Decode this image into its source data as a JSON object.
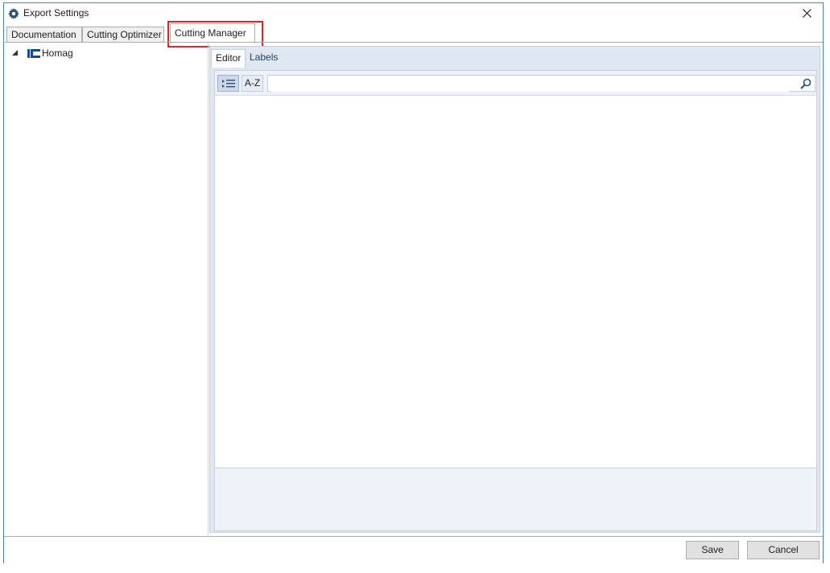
{
  "window": {
    "title": "Export Settings",
    "icon": "gear-icon"
  },
  "top_tabs": [
    {
      "label": "Documentation",
      "active": false
    },
    {
      "label": "Cutting Optimizer",
      "active": false
    },
    {
      "label": "Cutting Manager",
      "active": true
    }
  ],
  "tree": {
    "items": [
      {
        "label": "Homag",
        "expanded": true,
        "icon": "homag-logo-icon"
      }
    ]
  },
  "sub_tabs": [
    {
      "label": "Editor",
      "active": true
    },
    {
      "label": "Labels",
      "active": false
    }
  ],
  "toolbar": {
    "sort_az_label": "A-Z",
    "search": {
      "value": "",
      "placeholder": ""
    }
  },
  "footer": {
    "save_label": "Save",
    "cancel_label": "Cancel"
  },
  "colors": {
    "highlight": "#e0232a",
    "accent": "#4f7fbf",
    "panel_bg": "#dfe7f2"
  }
}
